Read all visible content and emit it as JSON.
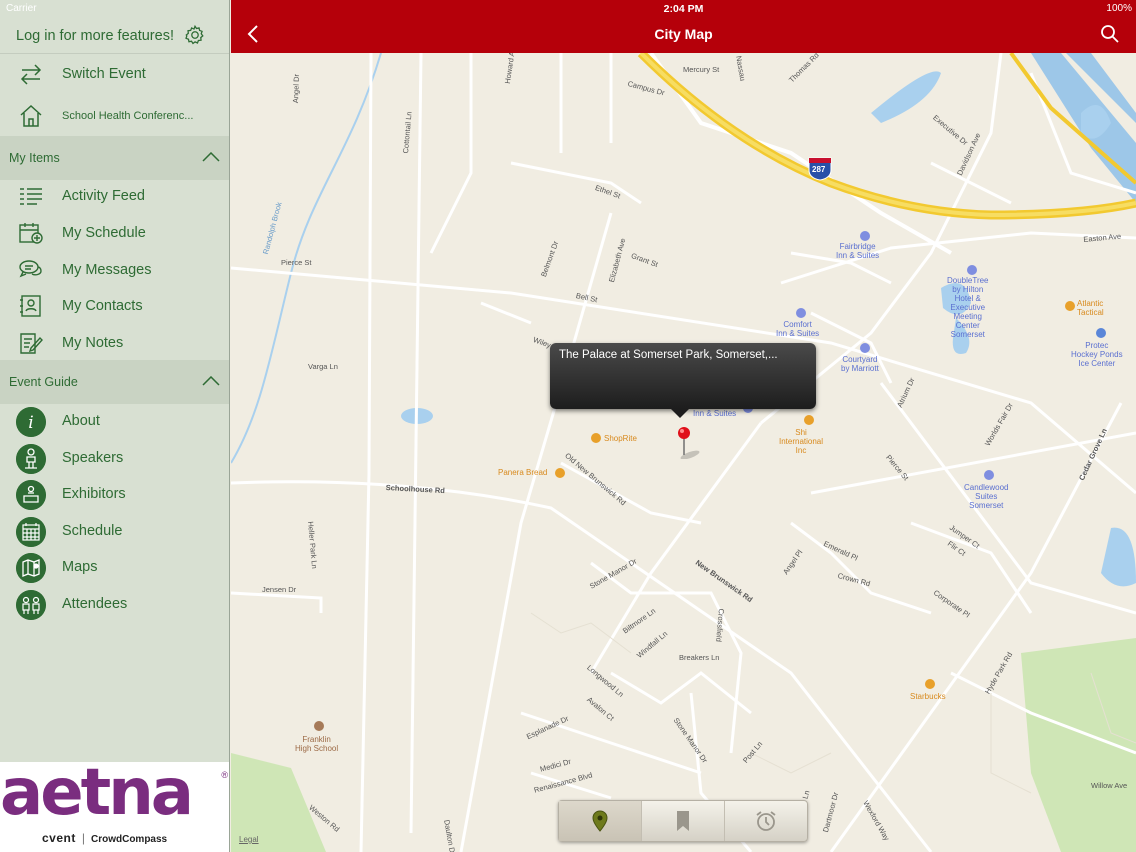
{
  "status": {
    "carrier": "Carrier",
    "time": "2:04 PM",
    "battery": "100%"
  },
  "sidebar": {
    "login_text": "Log in for more features!",
    "top_items": [
      {
        "label": "Switch Event",
        "icon": "switch-arrows-icon"
      },
      {
        "label": "School Health Conferenc...",
        "icon": "home-icon"
      }
    ],
    "my_items_header": "My Items",
    "my_items": [
      {
        "label": "Activity Feed",
        "icon": "list-icon"
      },
      {
        "label": "My Schedule",
        "icon": "calendar-add-icon"
      },
      {
        "label": "My Messages",
        "icon": "chat-bubbles-icon"
      },
      {
        "label": "My Contacts",
        "icon": "contact-card-icon"
      },
      {
        "label": "My Notes",
        "icon": "note-pencil-icon"
      }
    ],
    "event_guide_header": "Event Guide",
    "event_guide": [
      {
        "label": "About",
        "icon": "info-icon"
      },
      {
        "label": "Speakers",
        "icon": "speaker-icon"
      },
      {
        "label": "Exhibitors",
        "icon": "exhibitor-icon"
      },
      {
        "label": "Schedule",
        "icon": "calendar-grid-icon"
      },
      {
        "label": "Maps",
        "icon": "map-icon"
      },
      {
        "label": "Attendees",
        "icon": "people-icon"
      }
    ],
    "brand": {
      "logo": "aetna",
      "reg_mark": "®",
      "cvent": "cvent",
      "separator": "|",
      "crowdcompass": "CrowdCompass"
    }
  },
  "header": {
    "title": "City Map"
  },
  "map": {
    "callout_text": "The Palace at Somerset Park, Somerset,...",
    "legal": "Legal",
    "streets": [
      "Mercury St",
      "Nassau",
      "Thomas Rd",
      "Campus Dr",
      "Howard Ave",
      "Angel Dr",
      "Randolph Brook",
      "Cottontail Ln",
      "Executive Dr",
      "Davidson Ave",
      "Ethel St",
      "Grant St",
      "Belmont Dr",
      "Elizabeth Ave",
      "Pierce St",
      "Bell St",
      "Wiley Dr",
      "Easton Ave",
      "Varga Ln",
      "Schoolhouse Rd",
      "Old New Brunswick Rd",
      "Heller Park Ln",
      "New Brunswick Rd",
      "Jensen Dr",
      "Stone Manor Dr",
      "Biltmore Ln",
      "Windfall Ln",
      "Breakers Ln",
      "Crossfield",
      "Longwood Ln",
      "Avalon Ct",
      "Esplanade Dr",
      "Medici Dr",
      "Renaissance Blvd",
      "Stone Manor Dr",
      "Post Ln",
      "Weston Rd",
      "Daulton Dr",
      "Emerald Pl",
      "Crown Rd",
      "Angel Pl",
      "Corporate Pl",
      "Jumper Ct",
      "Flir Ct",
      "Atrium Dr",
      "Worlds Fair Dr",
      "Cedar Grove Ln",
      "Hyde Park Rd",
      "Willow Ave",
      "Cedar Grove Ln",
      "Dartmoor Dr",
      "Wexford Way",
      "Pierce St"
    ],
    "pois": [
      {
        "name": "Fairbridge\nInn & Suites",
        "kind": "hotel"
      },
      {
        "name": "DoubleTree\nby Hilton\nHotel &\nExecutive\nMeeting\nCenter\nSomerset",
        "kind": "hotel"
      },
      {
        "name": "Comfort\nInn & Suites",
        "kind": "hotel"
      },
      {
        "name": "Courtyard\nby Marriott",
        "kind": "hotel"
      },
      {
        "name": "Atlantic\nTactical",
        "kind": "shop"
      },
      {
        "name": "Protec\nHockey Ponds\nIce Center",
        "kind": "sport"
      },
      {
        "name": "Inn & Suites",
        "kind": "hotel"
      },
      {
        "name": "ShopRite",
        "kind": "shop"
      },
      {
        "name": "Shi\nInternational\nInc",
        "kind": "shop"
      },
      {
        "name": "Panera Bread",
        "kind": "food"
      },
      {
        "name": "Candlewood\nSuites\nSomerset",
        "kind": "hotel"
      },
      {
        "name": "Starbucks",
        "kind": "food"
      },
      {
        "name": "Franklin\nHigh School",
        "kind": "school"
      }
    ],
    "highway_shield": "287"
  },
  "toolbar": {
    "buttons": [
      "map-pin-icon",
      "bookmark-icon",
      "alarm-clock-icon"
    ],
    "active": 0
  },
  "colors": {
    "header": "#b5000a",
    "sidebar": "#d8e0d2",
    "accent_green": "#2e6b34",
    "brand_purple": "#7a2d7f",
    "map_bg": "#f1ede2",
    "highway": "#f2c930"
  }
}
